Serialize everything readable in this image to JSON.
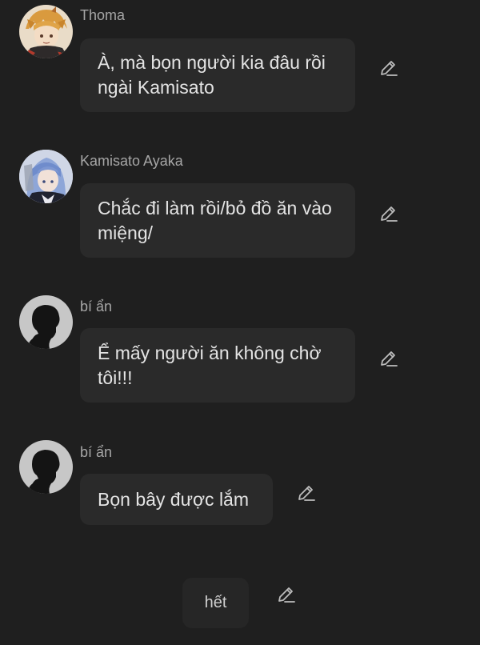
{
  "messages": [
    {
      "sender": "Thoma",
      "text": "À, mà bọn người kia đâu rồi ngài Kamisato",
      "avatar_icon": "thoma-avatar"
    },
    {
      "sender": "Kamisato Ayaka",
      "text": "Chắc đi làm rồi/bỏ đồ ăn vào miệng/",
      "avatar_icon": "ayaka-avatar"
    },
    {
      "sender": "bí ẩn",
      "text": "Ể mấy người ăn không chờ tôi!!!",
      "avatar_icon": "silhouette-avatar"
    },
    {
      "sender": "bí ẩn",
      "text": "Bọn bây được lắm",
      "avatar_icon": "silhouette-avatar"
    }
  ],
  "end_bubble": {
    "text": "hết"
  },
  "icons": {
    "edit": "pencil-edit-icon"
  },
  "colors": {
    "background": "#1f1f1f",
    "bubble": "#2a2a2a",
    "name": "#a6a6a6",
    "text": "#e4e4e4",
    "icon": "#bdbdbd"
  }
}
